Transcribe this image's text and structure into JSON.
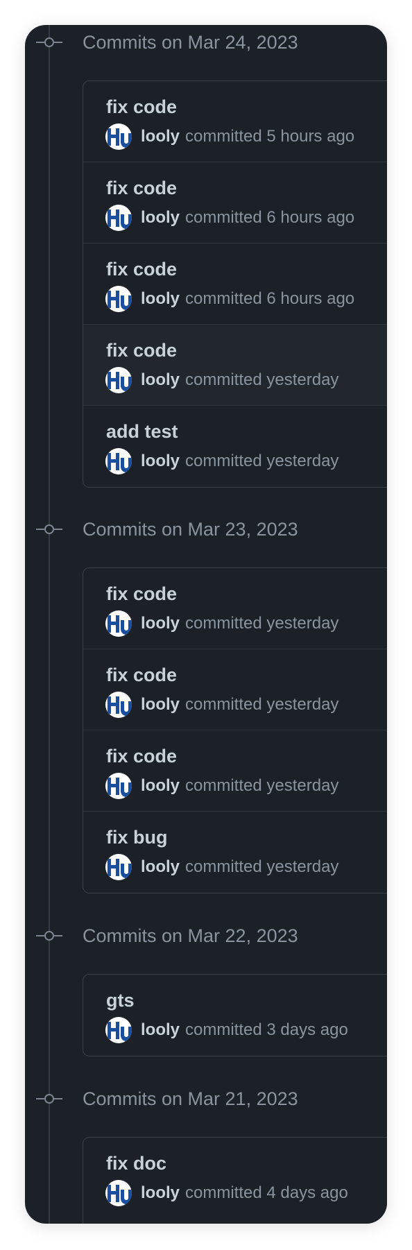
{
  "groups": [
    {
      "title": "Commits on Mar 24, 2023",
      "commits": [
        {
          "message": "fix code",
          "author": "looly",
          "time": "committed 5 hours ago"
        },
        {
          "message": "fix code",
          "author": "looly",
          "time": "committed 6 hours ago"
        },
        {
          "message": "fix code",
          "author": "looly",
          "time": "committed 6 hours ago"
        },
        {
          "message": "fix code",
          "author": "looly",
          "time": "committed yesterday"
        },
        {
          "message": "add test",
          "author": "looly",
          "time": "committed yesterday"
        }
      ]
    },
    {
      "title": "Commits on Mar 23, 2023",
      "commits": [
        {
          "message": "fix code",
          "author": "looly",
          "time": "committed yesterday"
        },
        {
          "message": "fix code",
          "author": "looly",
          "time": "committed yesterday"
        },
        {
          "message": "fix code",
          "author": "looly",
          "time": "committed yesterday"
        },
        {
          "message": "fix bug",
          "author": "looly",
          "time": "committed yesterday"
        }
      ]
    },
    {
      "title": "Commits on Mar 22, 2023",
      "commits": [
        {
          "message": "gts",
          "author": "looly",
          "time": "committed 3 days ago"
        }
      ]
    },
    {
      "title": "Commits on Mar 21, 2023",
      "commits": [
        {
          "message": "fix doc",
          "author": "looly",
          "time": "committed 4 days ago"
        }
      ]
    }
  ],
  "avatar_icon": "hutool-logo-avatar",
  "commit_node_icon": "git-commit-icon",
  "colors": {
    "background": "#1c2128",
    "text_primary": "#c9d1d9",
    "text_secondary": "#8b949e",
    "avatar_brand": "#1a4fa0"
  }
}
